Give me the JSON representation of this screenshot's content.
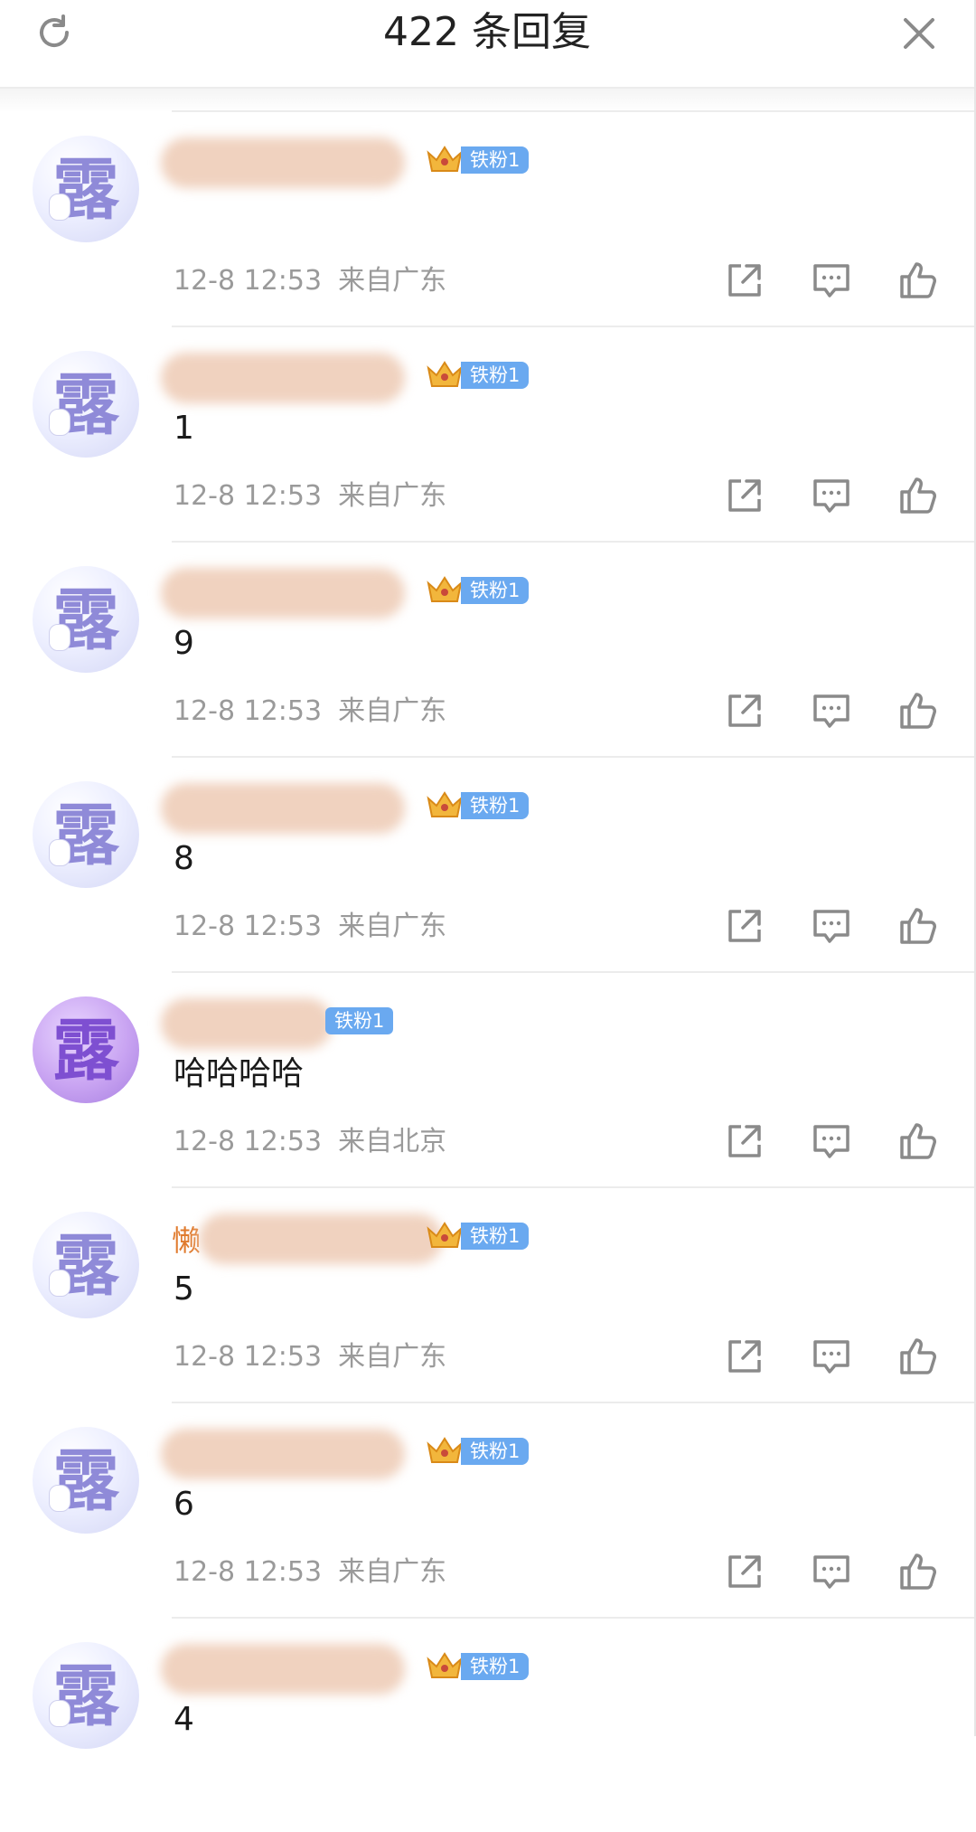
{
  "header": {
    "title": "422 条回复",
    "refresh_icon": "refresh-icon",
    "close_icon": "close-icon"
  },
  "fan_badge_label": "铁粉1",
  "comments": [
    {
      "name_hint": "",
      "text": "",
      "date": "12-8 12:53",
      "location": "来自广东",
      "avatar_glyph": "露"
    },
    {
      "name_hint": "",
      "text": "1",
      "date": "12-8 12:53",
      "location": "来自广东",
      "avatar_glyph": "露"
    },
    {
      "name_hint": "",
      "text": "9",
      "date": "12-8 12:53",
      "location": "来自广东",
      "avatar_glyph": "露"
    },
    {
      "name_hint": "",
      "text": "8",
      "date": "12-8 12:53",
      "location": "来自广东",
      "avatar_glyph": "露"
    },
    {
      "name_hint": "",
      "text": "哈哈哈哈",
      "date": "12-8 12:53",
      "location": "来自北京",
      "avatar_glyph": "露"
    },
    {
      "name_hint": "懒",
      "text": "5",
      "date": "12-8 12:53",
      "location": "来自广东",
      "avatar_glyph": "露"
    },
    {
      "name_hint": "",
      "text": "6",
      "date": "12-8 12:53",
      "location": "来自广东",
      "avatar_glyph": "露"
    },
    {
      "name_hint": "",
      "text": "4",
      "date": "",
      "location": "",
      "avatar_glyph": "露"
    }
  ],
  "action_icons": [
    "share-icon",
    "comment-icon",
    "like-icon"
  ],
  "colors": {
    "badge_blue": "#6aa9f0",
    "name_orange": "#e07b2e",
    "meta_gray": "#9a9a9a"
  }
}
